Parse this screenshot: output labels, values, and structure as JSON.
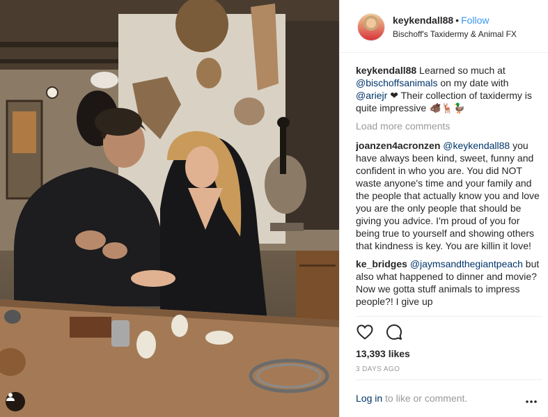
{
  "post": {
    "username": "keykendall88",
    "separator": "•",
    "follow_label": "Follow",
    "location": "Bischoff's Taxidermy & Animal FX"
  },
  "caption": {
    "user": "keykendall88",
    "text_1": " Learned so much at ",
    "mention_1": "@bischoffsanimals",
    "text_2": " on my date with ",
    "mention_2": "@ariejr",
    "text_3": " ❤ Their collection of taxidermy is quite impressive 🐗🦌🦆"
  },
  "load_more_label": "Load more comments",
  "comments": [
    {
      "user": "joanzen4acronzen",
      "mention": "@keykendall88",
      "text": " you have always been kind, sweet, funny and confident in who you are. You did NOT waste anyone's time and your family and the people that actually know you and love you are the only people that should be giving you advice. I'm proud of you for being true to yourself and showing others that kindness is key. You are killin it love!"
    },
    {
      "user": "ke_bridges",
      "mention": "@jaymsandthegiantpeach",
      "text": " but also what happened to dinner and movie? Now we gotta stuff animals to impress people?! I give up"
    }
  ],
  "likes": "13,393 likes",
  "time_ago": "3 DAYS AGO",
  "login": {
    "link": "Log in",
    "text": " to like or comment."
  },
  "icons": {
    "like": "heart-outline-icon",
    "comment": "speech-bubble-icon",
    "more": "ellipsis-icon",
    "tag": "tagged-user-icon"
  },
  "colors": {
    "link_blue": "#3897f0",
    "mention_navy": "#003569",
    "muted_gray": "#999999",
    "text": "#262626"
  }
}
